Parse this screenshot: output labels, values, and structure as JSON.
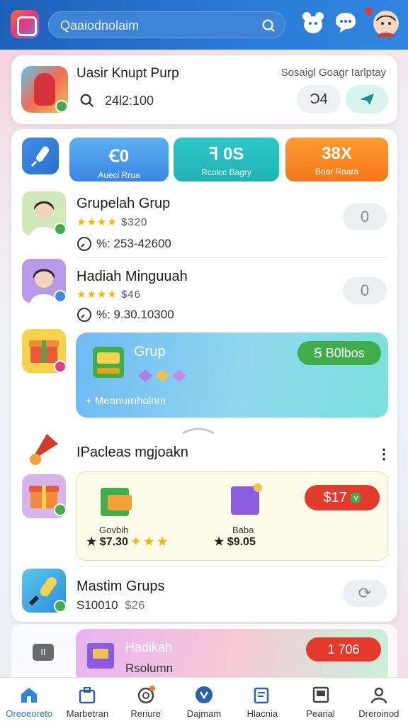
{
  "header": {
    "search_text": "Qaaiodnolaim",
    "icons": [
      "app-logo-icon",
      "search-icon",
      "bear-icon",
      "chat-icon",
      "avatar-icon"
    ]
  },
  "group_card": {
    "title": "Uasir Knupt Purp",
    "subtitle": "Sosaigl Goagr Iarlptay",
    "number": "24l2:100",
    "btn_a": "Ͻ4"
  },
  "stats": [
    {
      "value": "Ꞓ0",
      "label": "Aueci Rrua"
    },
    {
      "value": "ꟻ 0S",
      "label": "Rcolcc Bagry"
    },
    {
      "value": "38X",
      "label": "Boar Raara"
    }
  ],
  "rows": [
    {
      "title": "Grupelah Grup",
      "stars": "★★★★",
      "price": "$320",
      "meta": "%: 253-42600",
      "pill": "0"
    },
    {
      "title": "Hadiah Minguuah",
      "stars": "★★★★",
      "price": "$46",
      "meta": "%: 9.30.10300",
      "pill": "0"
    }
  ],
  "promo": {
    "title": "Grup",
    "button": "Ꞩ B0lbos",
    "subtitle": "+ Meanuırıholnm"
  },
  "section": {
    "title": "IPacleas mgjoakn"
  },
  "shop": {
    "item1_label": "Govbih",
    "item1_price": "$7.30",
    "item2_label": "Baba",
    "item2_price": "$9.05",
    "button": "$17"
  },
  "master": {
    "title": "Mastim Grups",
    "meta": "S10010",
    "price": "$26",
    "pill": "⟳"
  },
  "bottom_promo": {
    "title": "Hadikah",
    "sub": "Rsolumn",
    "button": "1 706",
    "pause": "II"
  },
  "tabs": [
    {
      "label": "Oreoeoreto",
      "icon": "home-icon"
    },
    {
      "label": "Marbetran",
      "icon": "shop-icon"
    },
    {
      "label": "Reriure",
      "icon": "target-icon"
    },
    {
      "label": "Dajmam",
      "icon": "game-icon"
    },
    {
      "label": "Hlacnia",
      "icon": "edit-icon"
    },
    {
      "label": "Pearial",
      "icon": "screen-icon"
    },
    {
      "label": "Dreroinod",
      "icon": "profile-icon"
    }
  ]
}
